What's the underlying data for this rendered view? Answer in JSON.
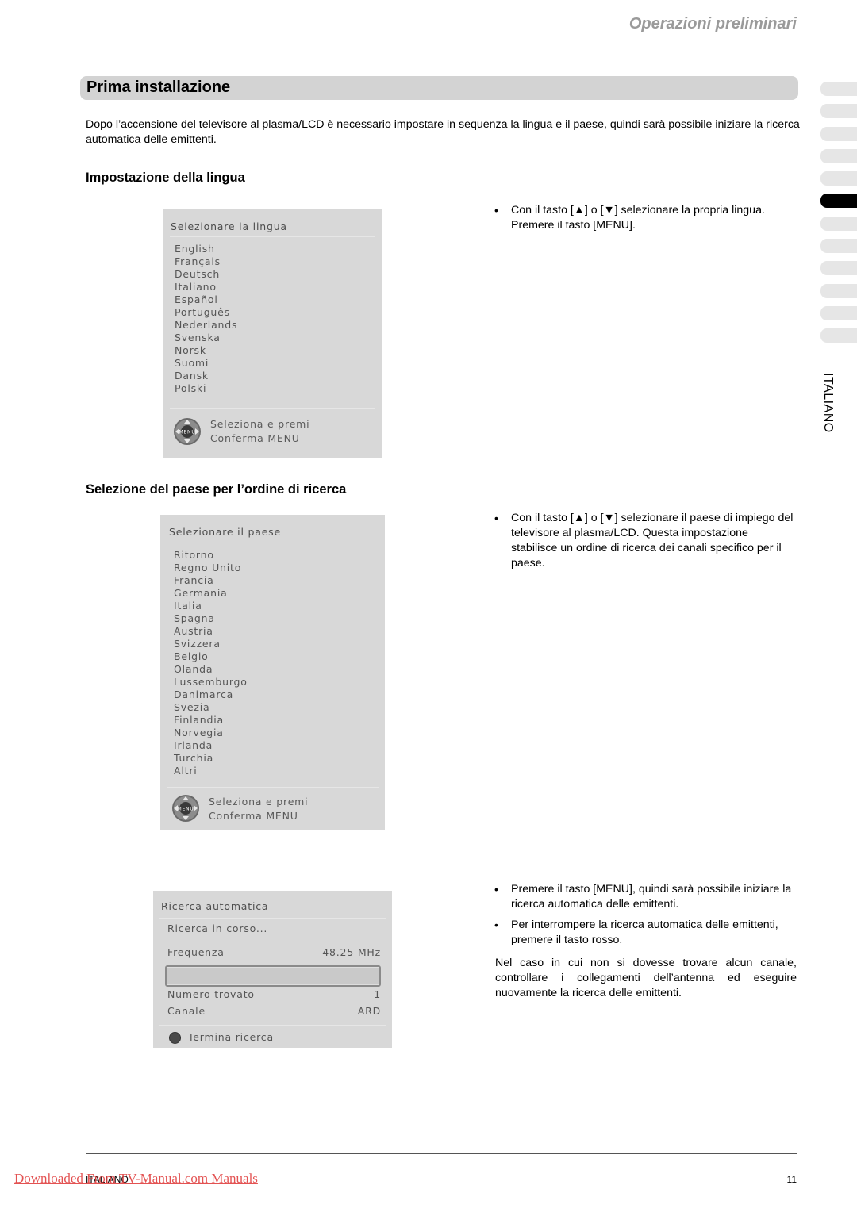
{
  "header": {
    "section": "Operazioni preliminari"
  },
  "title": "Prima installazione",
  "intro": "Dopo l’accensione del televisore al plasma/LCD è necessario impostare in sequenza la lingua e il paese, quindi sarà possibile iniziare la ricerca automatica delle emittenti.",
  "side": {
    "tabs_count": 12,
    "active_tab_index": 5,
    "language_label": "ITALIANO"
  },
  "language_section": {
    "heading": "Impostazione della lingua",
    "osd": {
      "title": "Selezionare la lingua",
      "items": [
        "English",
        "Français",
        "Deutsch",
        "Italiano",
        "Español",
        "Português",
        "Nederlands",
        "Svenska",
        "Norsk",
        "Suomi",
        "Dansk",
        "Polski"
      ],
      "footer_line1": "Seleziona e premi",
      "footer_line2": "Conferma MENU",
      "icon": "dpad-menu-icon"
    },
    "bullets": [
      {
        "pre": "Con il tasto [",
        "up": "▲",
        "mid": "] o [",
        "down": "▼",
        "post": "] selezionare la propria lingua. Premere il tasto [MENU]."
      }
    ]
  },
  "country_section": {
    "heading": "Selezione del paese per l’ordine di ricerca",
    "osd": {
      "title": "Selezionare il paese",
      "items": [
        "Ritorno",
        "Regno Unito",
        "Francia",
        "Germania",
        "Italia",
        "Spagna",
        "Austria",
        "Svizzera",
        "Belgio",
        "Olanda",
        "Lussemburgo",
        "Danimarca",
        "Svezia",
        "Finlandia",
        "Norvegia",
        "Irlanda",
        "Turchia",
        "Altri"
      ],
      "footer_line1": "Seleziona e premi",
      "footer_line2": "Conferma MENU",
      "icon": "dpad-menu-icon"
    },
    "bullets": [
      {
        "pre": "Con il tasto [",
        "up": "▲",
        "mid": "] o [",
        "down": "▼",
        "post": "] selezionare il paese di impiego del televisore al plasma/LCD. Questa impostazione stabilisce un ordine di ricerca dei canali specifico per il paese."
      }
    ]
  },
  "search_section": {
    "osd": {
      "title": "Ricerca automatica",
      "status": "Ricerca in corso...",
      "frequency_label": "Frequenza",
      "frequency_value": "48.25 MHz",
      "found_label": "Numero trovato",
      "found_value": "1",
      "channel_label": "Canale",
      "channel_value": "ARD",
      "stop_label": "Termina ricerca",
      "stop_color": "#4a4a4a"
    },
    "bullets": [
      "Premere il tasto [MENU], quindi sarà possibile iniziare la ricerca automatica delle emittenti.",
      "Per interrompere la ricerca automatica delle emittenti, premere il tasto rosso."
    ],
    "note": "Nel caso in cui non si dovesse trovare alcun canale, controllare i collegamenti dell’antenna ed eseguire nuovamente la ricerca delle emittenti."
  },
  "footer": {
    "language": "ITALIANO",
    "page_number": "11",
    "download_link": "Downloaded From TV-Manual.com Manuals",
    "link_color": "#e04040"
  }
}
